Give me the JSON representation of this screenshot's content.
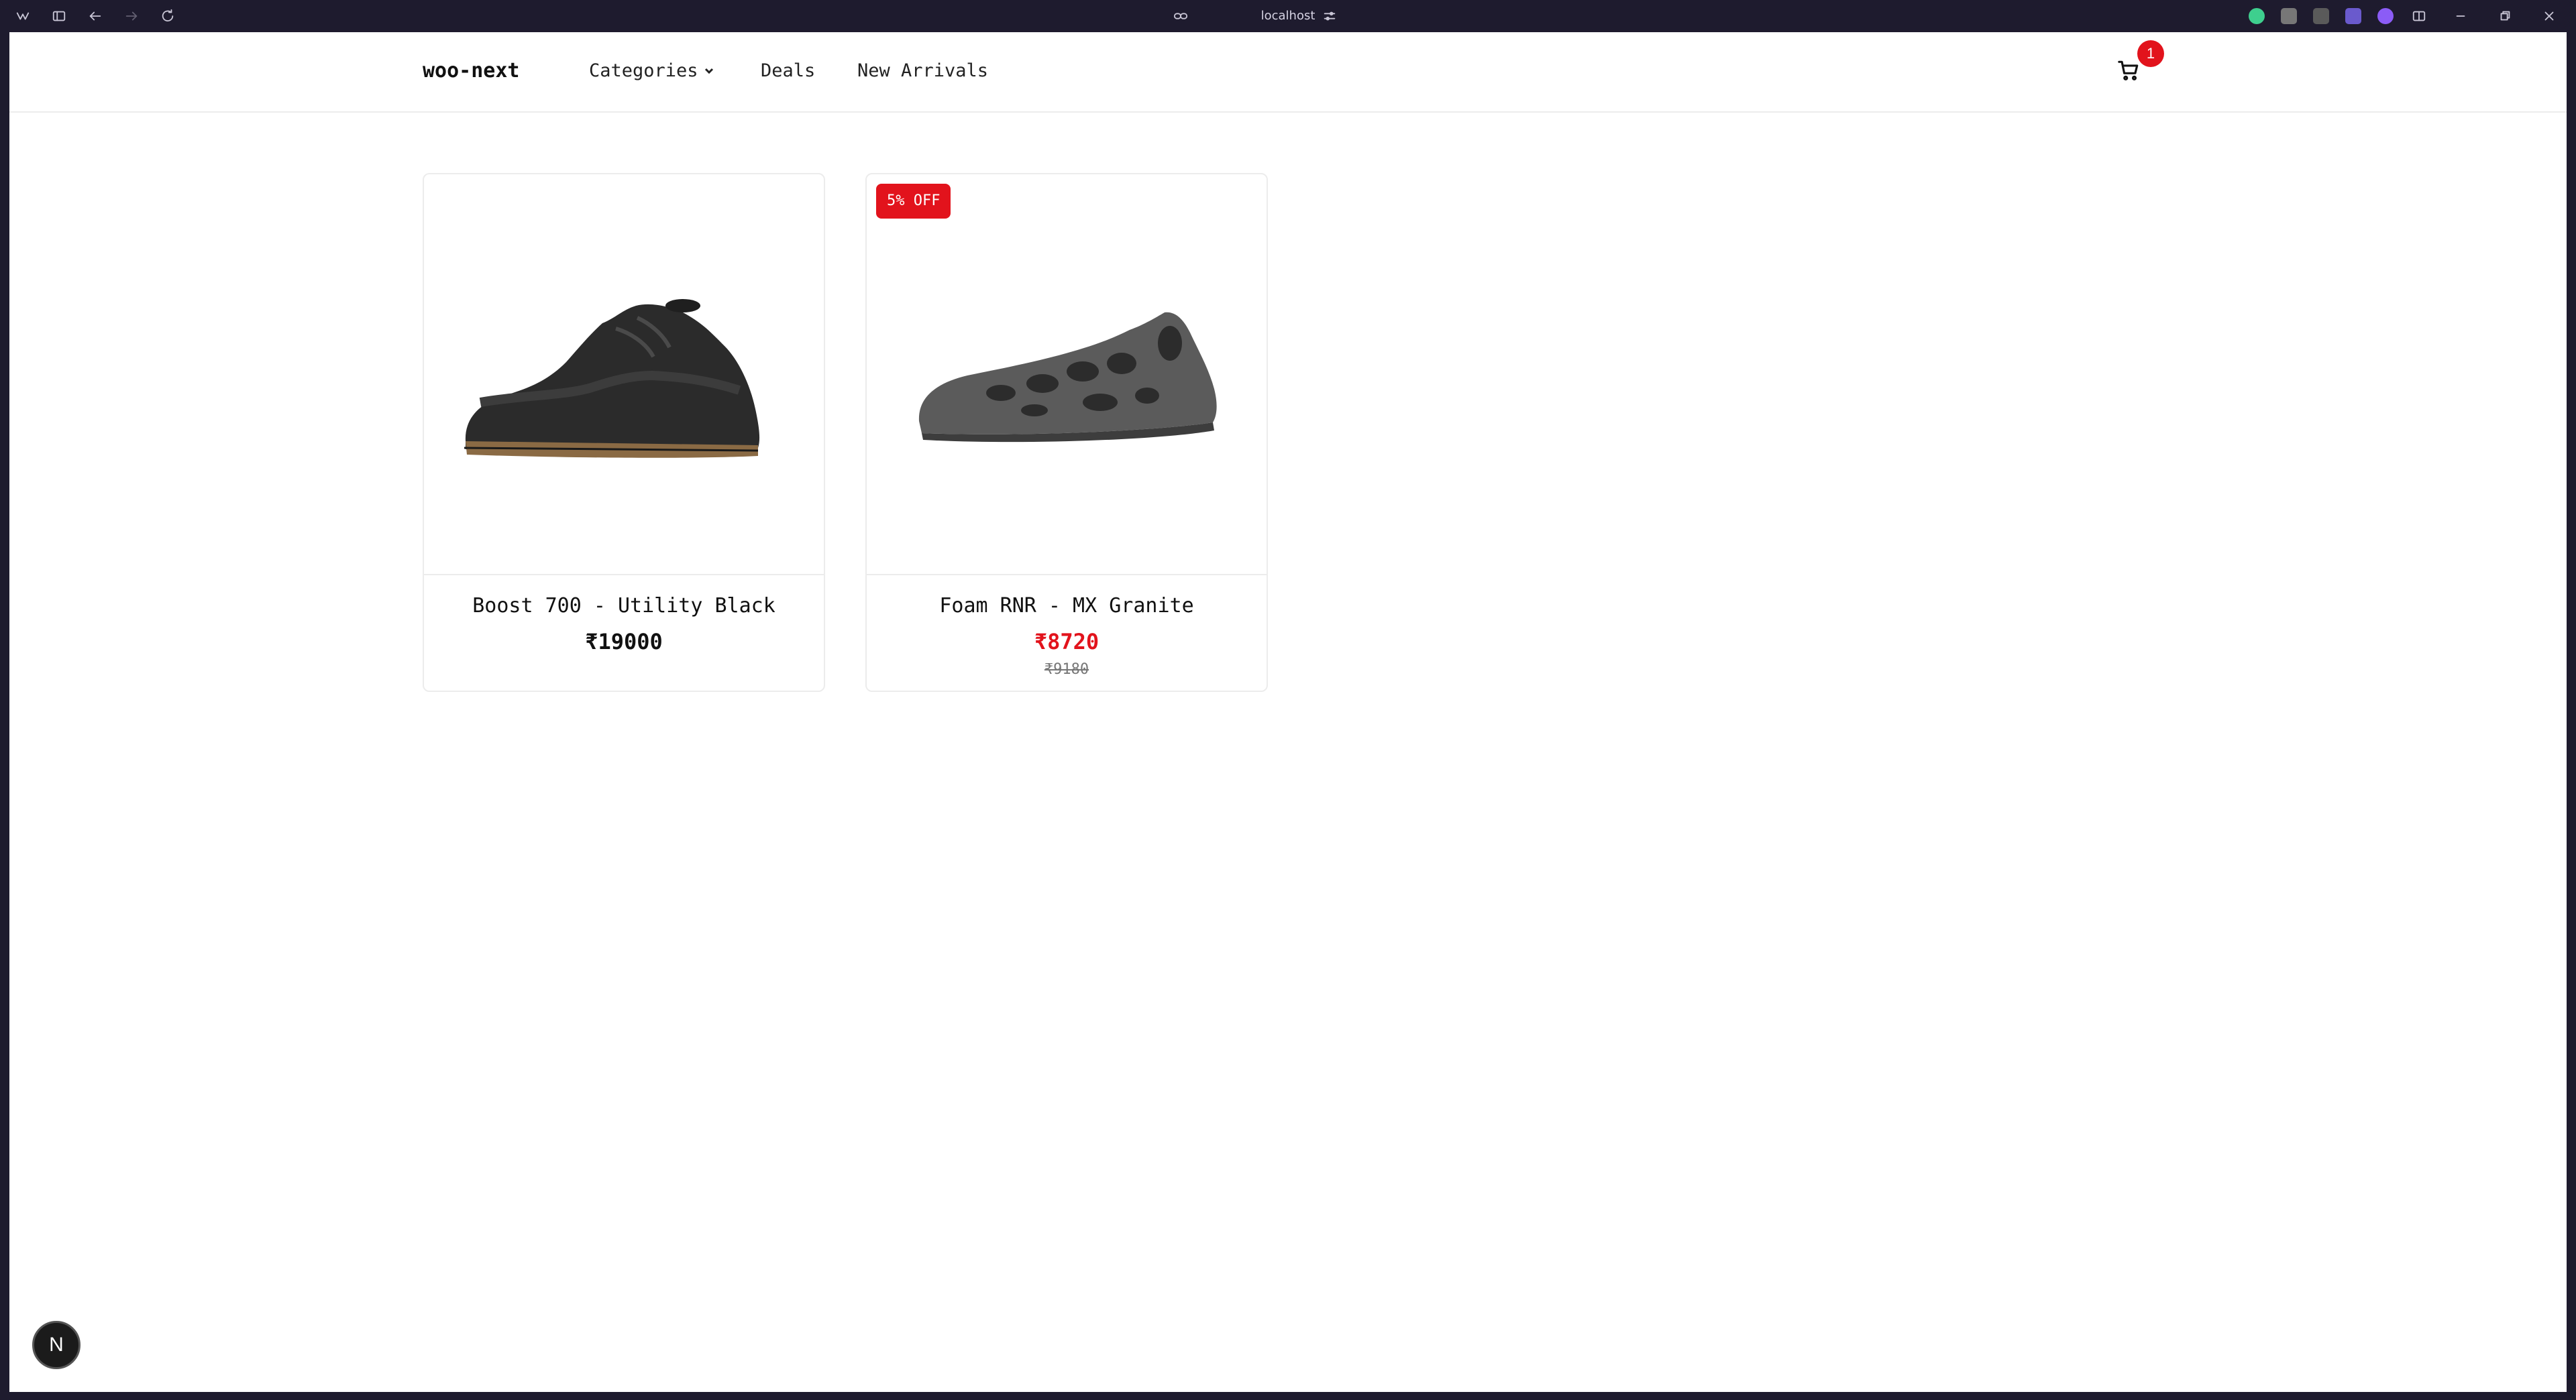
{
  "browser": {
    "url": "localhost",
    "extension_colors": [
      "#3ecf8e",
      "#777777",
      "#9a9a9a",
      "#6a5acd",
      "#8b5cf6"
    ]
  },
  "header": {
    "brand": "woo-next",
    "nav": [
      {
        "label": "Categories",
        "icon": "chevron-down-icon"
      },
      {
        "label": "Deals"
      },
      {
        "label": "New Arrivals"
      }
    ],
    "cart_count": "1"
  },
  "products": [
    {
      "title": "Boost 700 - Utility Black",
      "price": "₹19000"
    },
    {
      "title": "Foam RNR - MX Granite",
      "price": "₹8720",
      "regular_price": "₹9180",
      "badge": "5% OFF"
    }
  ],
  "dev_indicator": "N",
  "colors": {
    "accent": "#e2131c"
  }
}
